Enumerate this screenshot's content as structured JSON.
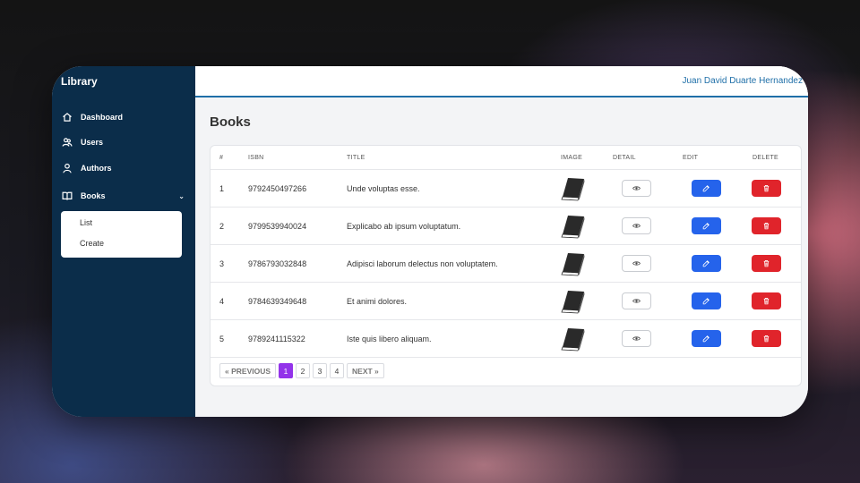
{
  "app": {
    "brand": "Library",
    "user": "Juan David Duarte Hernandez"
  },
  "sidebar": {
    "items": [
      {
        "label": "Dashboard",
        "icon": "home-icon"
      },
      {
        "label": "Users",
        "icon": "users-icon"
      },
      {
        "label": "Authors",
        "icon": "user-icon"
      },
      {
        "label": "Books",
        "icon": "book-open-icon",
        "expanded": true
      }
    ],
    "submenu": [
      {
        "label": "List"
      },
      {
        "label": "Create"
      }
    ]
  },
  "page": {
    "title": "Books"
  },
  "table": {
    "headers": [
      "#",
      "ISBN",
      "TITLE",
      "IMAGE",
      "DETAIL",
      "EDIT",
      "DELETE"
    ],
    "rows": [
      {
        "num": "1",
        "isbn": "9792450497266",
        "title": "Unde voluptas esse."
      },
      {
        "num": "2",
        "isbn": "9799539940024",
        "title": "Explicabo ab ipsum voluptatum."
      },
      {
        "num": "3",
        "isbn": "9786793032848",
        "title": "Adipisci laborum delectus non voluptatem."
      },
      {
        "num": "4",
        "isbn": "9784639349648",
        "title": "Et animi dolores."
      },
      {
        "num": "5",
        "isbn": "9789241115322",
        "title": "Iste quis libero aliquam."
      }
    ]
  },
  "pagination": {
    "prev": "« PREVIOUS",
    "next": "NEXT »",
    "pages": [
      "1",
      "2",
      "3",
      "4"
    ],
    "current": "1"
  },
  "colors": {
    "sidebar": "#0b2d4a",
    "accent": "#1f6fa8",
    "edit": "#2563eb",
    "delete": "#e0242b",
    "active_page": "#9333ea"
  }
}
